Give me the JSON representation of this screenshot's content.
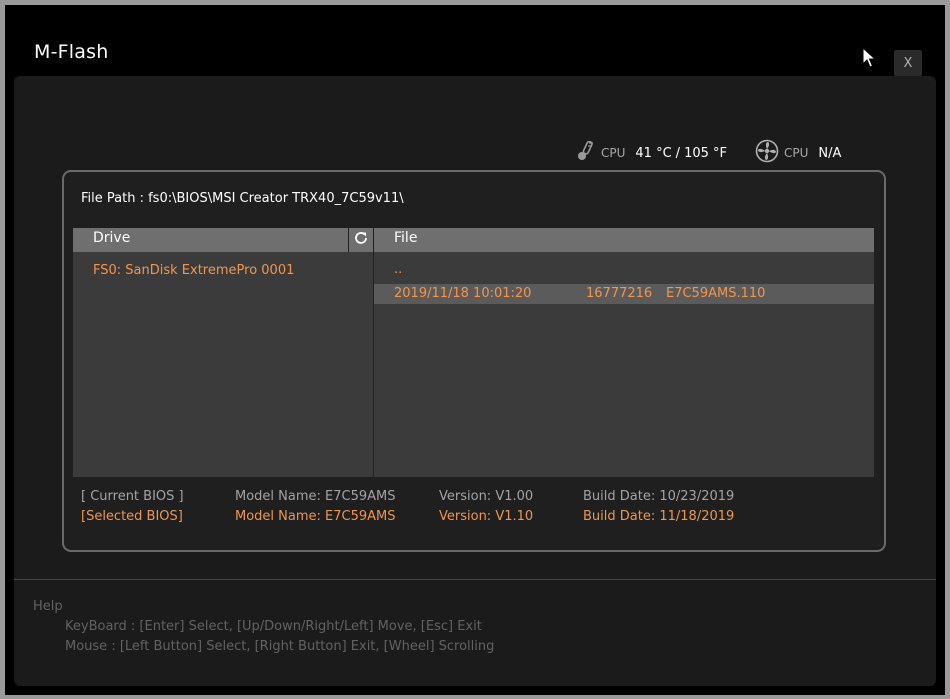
{
  "window": {
    "title": "M-Flash",
    "close_label": "X"
  },
  "sensors": {
    "cpu_temp": {
      "label": "CPU",
      "celsius": "41 °C",
      "separator": "/",
      "fahrenheit": "105 °F",
      "icon": "thermometer-icon"
    },
    "cpu_fan": {
      "label": "CPU",
      "value": "N/A",
      "icon": "fan-icon"
    }
  },
  "file_browser": {
    "file_path_label": "File Path :",
    "file_path": "fs0:\\BIOS\\MSI Creator TRX40_7C59v11\\",
    "drive_header": "Drive",
    "file_header": "File",
    "refresh_icon": "refresh-icon",
    "drives": [
      "FS0: SanDisk ExtremePro 0001"
    ],
    "parent_dir": "..",
    "files": [
      {
        "date": "2019/11/18 10:01:20",
        "size": "16777216",
        "name": "E7C59AMS.110"
      }
    ]
  },
  "bios": {
    "current": {
      "label": "[ Current BIOS  ]",
      "model": "Model Name: E7C59AMS",
      "version": "Version: V1.00",
      "build_date": "Build Date: 10/23/2019"
    },
    "selected": {
      "label": "[Selected BIOS]",
      "model": "Model Name: E7C59AMS",
      "version": "Version: V1.10",
      "build_date": "Build Date: 11/18/2019"
    }
  },
  "help": {
    "title": "Help",
    "keyboard": "KeyBoard :   [Enter]  Select,   [Up/Down/Right/Left]  Move,   [Esc]  Exit",
    "mouse": "Mouse     :   [Left Button]  Select,   [Right Button]  Exit,   [Wheel]  Scrolling"
  },
  "colors": {
    "accent": "#f09650",
    "header_bar": "#6f6f6f",
    "list_bg": "#3b3b3b",
    "selected_row": "#5b5b5b"
  }
}
